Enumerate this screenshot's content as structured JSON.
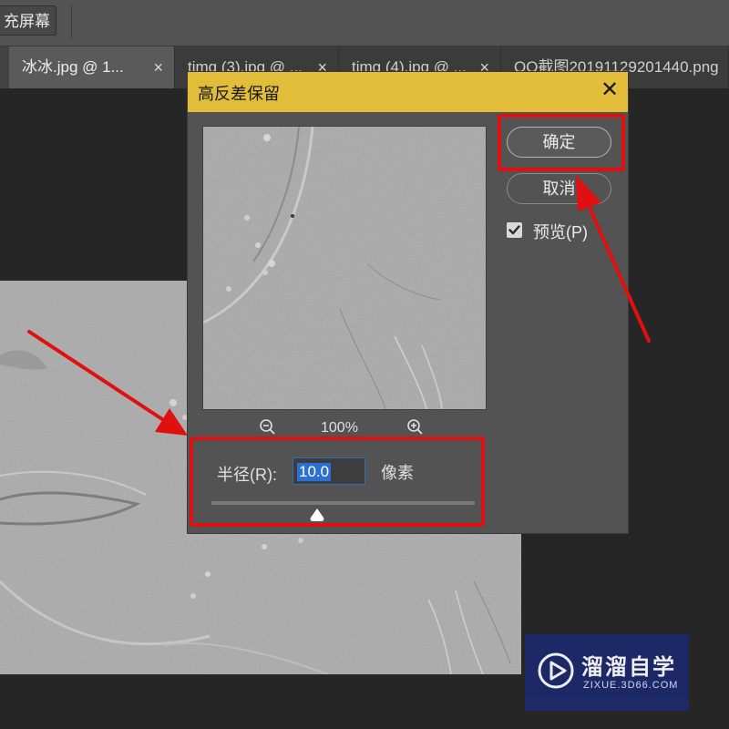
{
  "toolbar": {
    "fullscreen_label": "充屏幕"
  },
  "tabs": [
    {
      "label": "冰冰.jpg @ 1...",
      "close": "×"
    },
    {
      "label": "timg (3).jpg @ ...",
      "close": "×"
    },
    {
      "label": "timg (4).jpg @ ...",
      "close": "×"
    },
    {
      "label": "QQ截图20191129201440.png",
      "close": ""
    }
  ],
  "dialog": {
    "title": "高反差保留",
    "close_glyph": "✕",
    "zoom_level": "100%",
    "radius_label": "半径(R):",
    "radius_value": "10.0",
    "radius_unit": "像素",
    "slider_level": 0.39,
    "ok_label": "确定",
    "cancel_label": "取消",
    "preview_label": "预览(P)",
    "preview_checked": true
  },
  "watermark": {
    "name": "溜溜自学",
    "url": "ZIXUE.3D66.COM",
    "icon": "play-logo-icon"
  },
  "icons": {
    "zoom_out": "zoom-out-icon",
    "zoom_in": "zoom-in-icon",
    "checkbox": "checkmark-icon",
    "slider": "triangle-thumb-icon"
  },
  "colors": {
    "titlebar": "#e2bd3a",
    "annotation": "#e01010",
    "selection": "#2d6fd1",
    "watermark_bg": "#1c2a6c"
  }
}
